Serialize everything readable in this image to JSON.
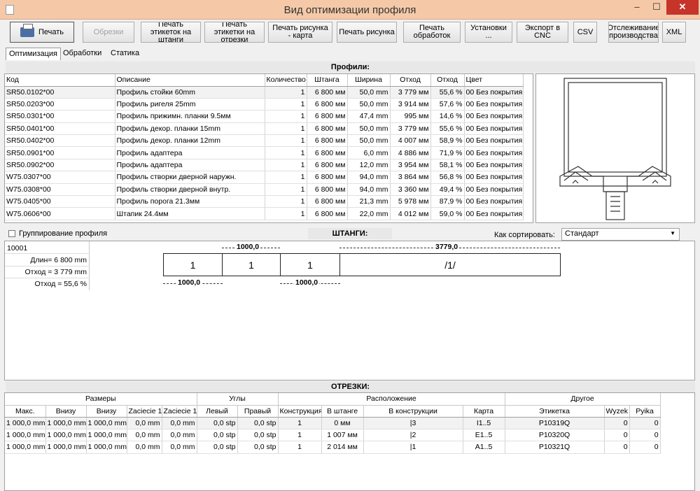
{
  "window": {
    "title": "Вид оптимизации профиля",
    "minimize": "–",
    "maximize": "☐",
    "close": "✕"
  },
  "toolbar": {
    "print": "Печать",
    "cuts": "Обрезки",
    "print_labels_bars": "Печать этикеток на штанги",
    "print_labels_cuts": "Печать этикетки на отрезки",
    "print_drawing_map": "Печать рисунка - карта",
    "print_drawing": "Печать рисунка",
    "print_operations": "Печать обработок",
    "settings": "Установки ...",
    "export_cnc": "Экспорт в CNC",
    "csv": "CSV",
    "tracking": "Отслеживание производства",
    "xml": "XML"
  },
  "tabs": [
    "Оптимизация",
    "Обработки",
    "Статика"
  ],
  "profiles": {
    "title": "Профили:",
    "columns": [
      "Код",
      "Описание",
      "Количество",
      "Штанга",
      "Ширина",
      "Отход",
      "Отход",
      "Цвет"
    ],
    "rows": [
      [
        "SR50.0102*00",
        "Профиль стойки 60mm",
        "1",
        "6 800 мм",
        "50,0 mm",
        "3 779 мм",
        "55,6 %",
        "00 Без покрытия"
      ],
      [
        "SR50.0203*00",
        "Профиль ригеля 25mm",
        "1",
        "6 800 мм",
        "50,0 mm",
        "3 914 мм",
        "57,6 %",
        "00 Без покрытия"
      ],
      [
        "SR50.0301*00",
        "Профиль прижимн. планки 9.5мм",
        "1",
        "6 800 мм",
        "47,4 mm",
        "995 мм",
        "14,6 %",
        "00 Без покрытия"
      ],
      [
        "SR50.0401*00",
        "Профиль декор. планки 15mm",
        "1",
        "6 800 мм",
        "50,0 mm",
        "3 779 мм",
        "55,6 %",
        "00 Без покрытия"
      ],
      [
        "SR50.0402*00",
        "Профиль декор. планки 12mm",
        "1",
        "6 800 мм",
        "50,0 mm",
        "4 007 мм",
        "58,9 %",
        "00 Без покрытия"
      ],
      [
        "SR50.0901*00",
        "Профиль адаптера",
        "1",
        "6 800 мм",
        "6,0 mm",
        "4 886 мм",
        "71,9 %",
        "00 Без покрытия"
      ],
      [
        "SR50.0902*00",
        "Профиль адаптера",
        "1",
        "6 800 мм",
        "12,0 mm",
        "3 954 мм",
        "58,1 %",
        "00 Без покрытия"
      ],
      [
        "W75.0307*00",
        "Профиль створки дверной наружн.",
        "1",
        "6 800 мм",
        "94,0 mm",
        "3 864 мм",
        "56,8 %",
        "00 Без покрытия"
      ],
      [
        "W75.0308*00",
        "Профиль створки дверной внутр.",
        "1",
        "6 800 мм",
        "94,0 mm",
        "3 360 мм",
        "49,4 %",
        "00 Без покрытия"
      ],
      [
        "W75.0405*00",
        "Профиль порога 21.3мм",
        "1",
        "6 800 мм",
        "21,3 mm",
        "5 978 мм",
        "87,9 %",
        "00 Без покрытия"
      ],
      [
        "W75.0606*00",
        "Штапик 24.4мм",
        "1",
        "6 800 мм",
        "22,0 mm",
        "4 012 мм",
        "59,0 %",
        "00 Без покрытия"
      ]
    ]
  },
  "bars": {
    "title": "ШТАНГИ:",
    "group_label": "Группирование профиля",
    "sort_label": "Как сортировать:",
    "sort_value": "Стандарт",
    "bar_id": "10001",
    "length": "Длин= 6 800 mm",
    "waste": "Отход = 3 779 mm",
    "waste_pct": "Отход = 55,6 %",
    "segments": [
      "1",
      "1",
      "1",
      "/1/"
    ],
    "dim_top_1": "1000,0",
    "dim_top_2": "3779,0",
    "dim_bottom_1": "1000,0",
    "dim_bottom_2": "1000,0"
  },
  "cuts": {
    "title": "ОТРЕЗКИ:",
    "groups": [
      "Размеры",
      "Углы",
      "Расположение",
      "Другое"
    ],
    "columns": [
      "Макс.",
      "Внизу",
      "Внизу",
      "Zaciecie 1",
      "Zaciecie 1",
      "Левый",
      "Правый",
      "Конструкция",
      "В штанге",
      "В конструкции",
      "Карта",
      "Этикетка",
      "Wyzek",
      "Pyika"
    ],
    "rows": [
      [
        "1 000,0 mm",
        "1 000,0 mm",
        "1 000,0 mm",
        "0,0 mm",
        "0,0 mm",
        "0,0 stp",
        "0,0 stp",
        "1",
        "0 мм",
        "|3",
        "I1..5",
        "P10319Q",
        "0",
        "0"
      ],
      [
        "1 000,0 mm",
        "1 000,0 mm",
        "1 000,0 mm",
        "0,0 mm",
        "0,0 mm",
        "0,0 stp",
        "0,0 stp",
        "1",
        "1 007 мм",
        "|2",
        "E1..5",
        "P10320Q",
        "0",
        "0"
      ],
      [
        "1 000,0 mm",
        "1 000,0 mm",
        "1 000,0 mm",
        "0,0 mm",
        "0,0 mm",
        "0,0 stp",
        "0,0 stp",
        "1",
        "2 014 мм",
        "|1",
        "A1..5",
        "P10321Q",
        "0",
        "0"
      ]
    ]
  }
}
